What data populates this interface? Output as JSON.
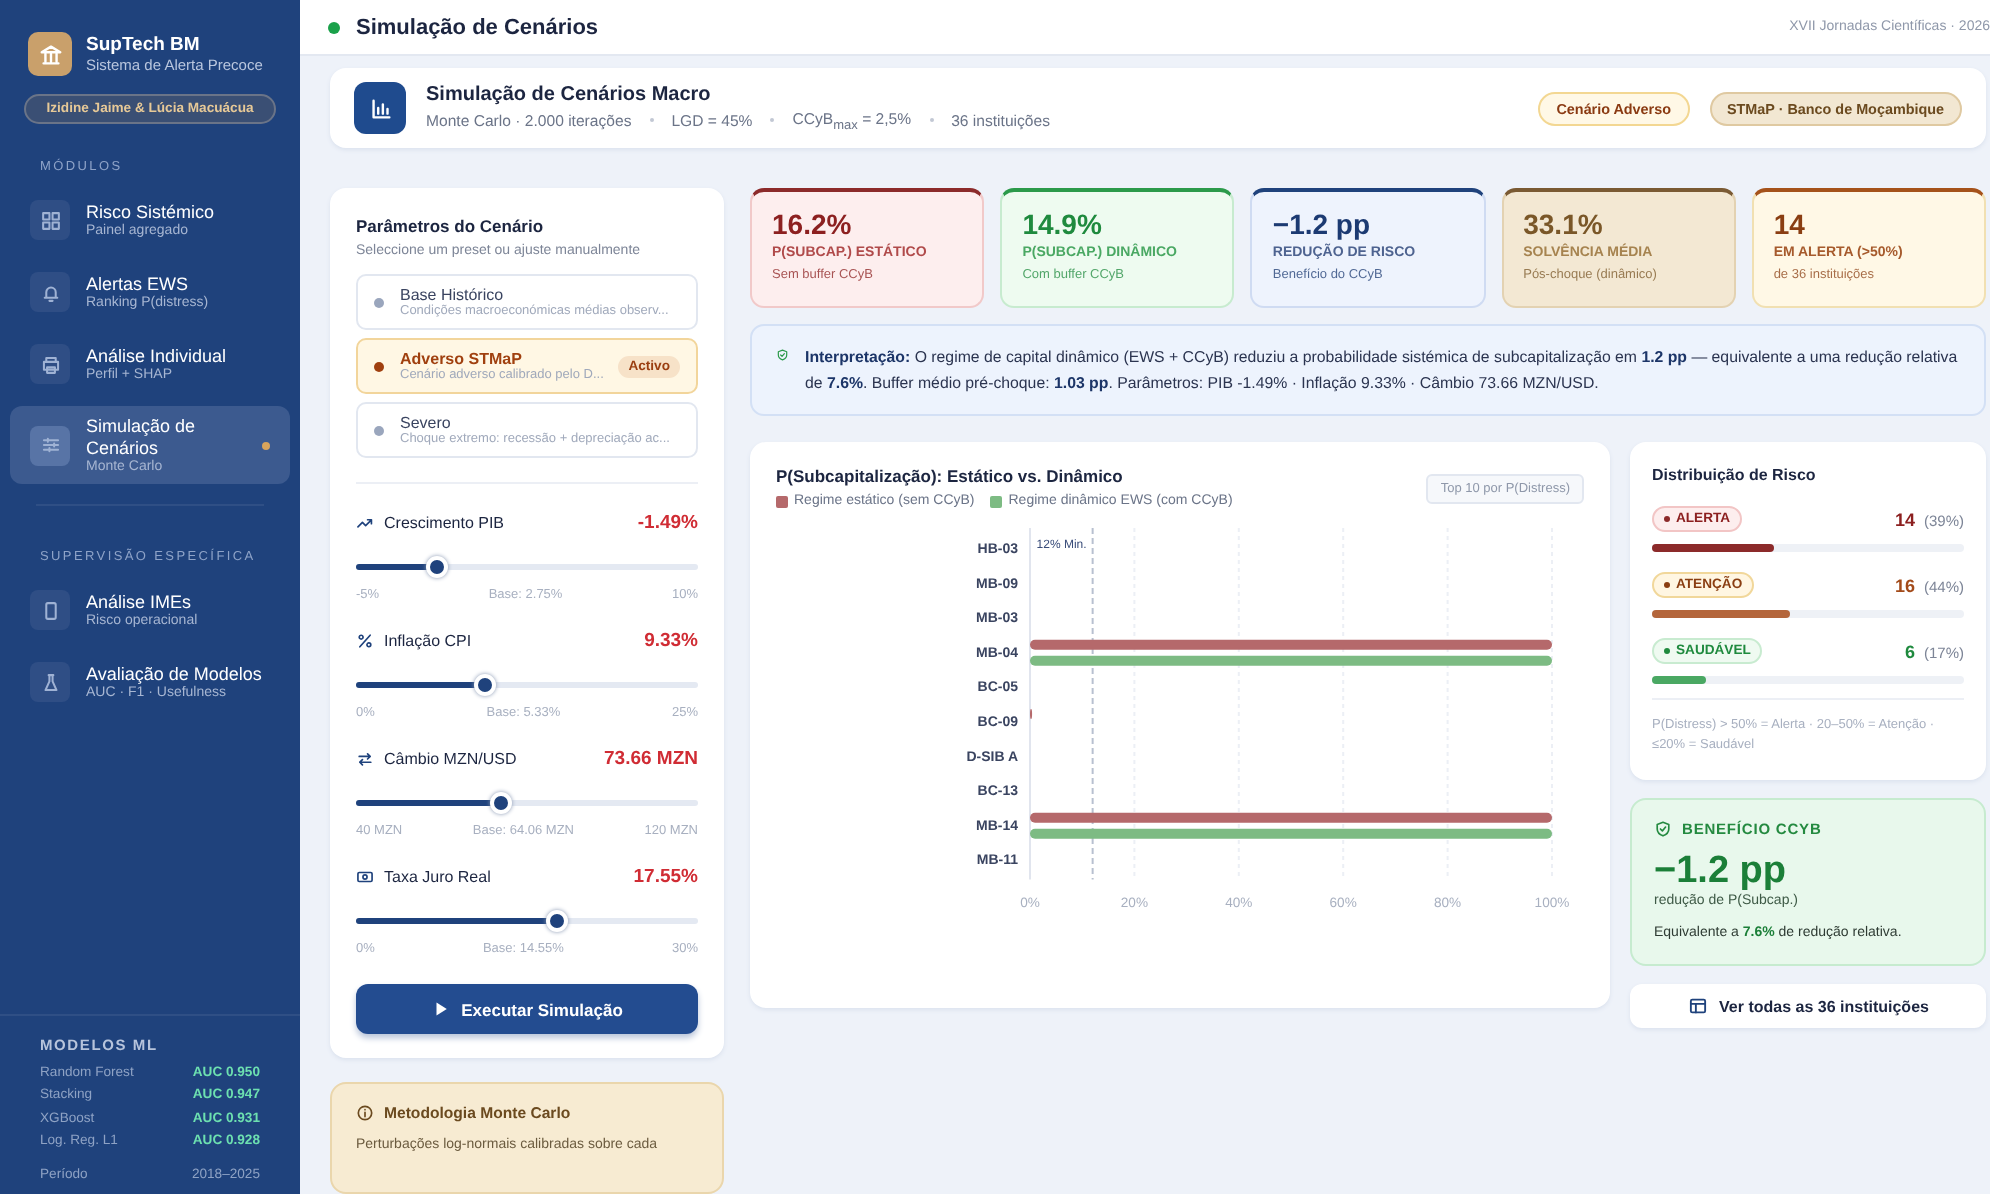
{
  "sidebar": {
    "brand": {
      "title": "SupTech BM",
      "subtitle": "Sistema de Alerta Precoce"
    },
    "authors": "Izidine Jaime & Lúcia Macuácua",
    "sections": [
      {
        "heading": "MÓDULOS",
        "items": [
          {
            "label": "Risco Sistémico",
            "sub": "Painel agregado",
            "selected": false
          },
          {
            "label": "Alertas EWS",
            "sub": "Ranking P(distress)",
            "selected": false
          },
          {
            "label": "Análise Individual",
            "sub": "Perfil + SHAP",
            "selected": false
          },
          {
            "label": "Simulação de Cenários",
            "sub": "Monte Carlo",
            "selected": true
          }
        ]
      },
      {
        "heading": "SUPERVISÃO ESPECÍFICA",
        "items": [
          {
            "label": "Análise IMEs",
            "sub": "Risco operacional",
            "selected": false
          },
          {
            "label": "Avaliação de Modelos",
            "sub": "AUC · F1 · Usefulness",
            "selected": false
          }
        ]
      }
    ],
    "models": {
      "heading": "MODELOS ML",
      "rows": [
        {
          "name": "Random Forest",
          "score": "AUC 0.950"
        },
        {
          "name": "Stacking",
          "score": "AUC 0.947"
        },
        {
          "name": "XGBoost",
          "score": "AUC 0.931"
        },
        {
          "name": "Log. Reg. L1",
          "score": "AUC 0.928"
        }
      ],
      "period_label": "Período",
      "period": "2018–2025"
    }
  },
  "topbar": {
    "title": "Simulação de Cenários",
    "event": "XVII Jornadas Científicas · 2026"
  },
  "header": {
    "title": "Simulação de Cenários Macro",
    "meta": [
      "Monte Carlo · 2.000 iterações",
      "LGD = 45%",
      "CCyB$_{max}$ = 2,5%",
      "36 instituições"
    ],
    "badges": [
      {
        "label": "Cenário Adverso",
        "kind": "warning"
      },
      {
        "label": "STMaP · Banco de Moçambique",
        "kind": "source"
      }
    ]
  },
  "params": {
    "title": "Parâmetros do Cenário",
    "subtitle": "Seleccione um preset ou ajuste manualmente",
    "presets": [
      {
        "name": "Base Histórico",
        "desc": "Condições macroeconómicas médias observ...",
        "selected": false
      },
      {
        "name": "Adverso STMaP",
        "desc": "Cenário adverso calibrado pelo D...",
        "selected": true,
        "badge": "Activo"
      },
      {
        "name": "Severo",
        "desc": "Choque extremo: recessão + depreciação ac...",
        "selected": false
      }
    ],
    "sliders": [
      {
        "label": "Crescimento PIB",
        "value": "-1.49%",
        "min": "-5%",
        "base": "Base: 2.75%",
        "max": "10%",
        "level": 0.234
      },
      {
        "label": "Inflação CPI",
        "value": "9.33%",
        "min": "0%",
        "base": "Base: 5.33%",
        "max": "25%",
        "level": 0.373
      },
      {
        "label": "Câmbio MZN/USD",
        "value": "73.66 MZN",
        "min": "40 MZN",
        "base": "Base: 64.06 MZN",
        "max": "120 MZN",
        "level": 0.42
      },
      {
        "label": "Taxa Juro Real",
        "value": "17.55%",
        "min": "0%",
        "base": "Base: 14.55%",
        "max": "30%",
        "level": 0.585
      }
    ],
    "run_button": "Executar Simulação"
  },
  "method": {
    "title": "Metodologia Monte Carlo",
    "text": "Perturbações log-normais calibradas sobre cada"
  },
  "kpis": [
    {
      "value": "16.2%",
      "label": "P(SUBCAP.) ESTÁTICO",
      "sub": "Sem buffer CCyB",
      "kind": "red"
    },
    {
      "value": "14.9%",
      "label": "P(SUBCAP.) DINÂMICO",
      "sub": "Com buffer CCyB",
      "kind": "green"
    },
    {
      "value": "−1.2 pp",
      "label": "REDUÇÃO DE RISCO",
      "sub": "Benefício do CCyB",
      "kind": "blue"
    },
    {
      "value": "33.1%",
      "label": "SOLVÊNCIA MÉDIA",
      "sub": "Pós-choque (dinâmico)",
      "kind": "tan"
    },
    {
      "value": "14",
      "label": "EM ALERTA (>50%)",
      "sub": "de 36 instituições",
      "kind": "amber"
    }
  ],
  "interpretation": "**Interpretação:** O regime de capital dinâmico (EWS + CCyB) reduziu a probabilidade sistémica de subcapitalização em **1.2 pp** — equivalente a uma redução relativa de **7.6%**. Buffer médio pré-choque: **1.03 pp**. Parâmetros: PIB -1.49% · Inflação 9.33% · Câmbio 73.66 MZN/USD.",
  "chart": {
    "title": "P(Subcapitalização): Estático vs. Dinâmico",
    "tag": "Top 10 por P(Distress)",
    "chart_data": {
      "type": "bar",
      "orientation": "horizontal",
      "categories": [
        "HB-03",
        "MB-09",
        "MB-03",
        "MB-04",
        "BC-05",
        "BC-09",
        "D-SIB A",
        "BC-13",
        "MB-14",
        "MB-11"
      ],
      "series": [
        {
          "name": "Regime estático (sem CCyB)",
          "color": "#b5696b",
          "values": [
            0,
            0,
            0,
            100,
            0,
            0.4,
            0,
            0,
            100,
            0
          ]
        },
        {
          "name": "Regime dinâmico EWS (com CCyB)",
          "color": "#7dbb83",
          "values": [
            0,
            0,
            0,
            100,
            0,
            0,
            0,
            0,
            100,
            0
          ]
        }
      ],
      "xlim": [
        0,
        100
      ],
      "xticks": [
        {
          "value": 0,
          "label": "0%"
        },
        {
          "value": 20,
          "label": "20%"
        },
        {
          "value": 40,
          "label": "40%"
        },
        {
          "value": 60,
          "label": "60%"
        },
        {
          "value": 80,
          "label": "80%"
        },
        {
          "value": 100,
          "label": "100%"
        }
      ],
      "grid": true,
      "ref_lines": [
        {
          "axis": "x",
          "value": 12,
          "label": "12% Min."
        }
      ]
    }
  },
  "distribution": {
    "title": "Distribuição de Risco",
    "rows": [
      {
        "label": "ALERTA",
        "count": "14",
        "pct": "(39%)",
        "level": 0.39,
        "kind": "alert"
      },
      {
        "label": "ATENÇÃO",
        "count": "16",
        "pct": "(44%)",
        "level": 0.44,
        "kind": "warn"
      },
      {
        "label": "SAUDÁVEL",
        "count": "6",
        "pct": "(17%)",
        "level": 0.17,
        "kind": "ok"
      }
    ],
    "note": "P(Distress) > 50% = Alerta · 20–50% = Atenção · ≤20% = Saudável"
  },
  "benefit": {
    "title": "BENEFÍCIO CCYB",
    "value": "−1.2 pp",
    "sub": "redução de P(Subcap.)",
    "text": "Equivalente a **7.6%** de redução relativa."
  },
  "view_all": "Ver todas as 36 instituições"
}
